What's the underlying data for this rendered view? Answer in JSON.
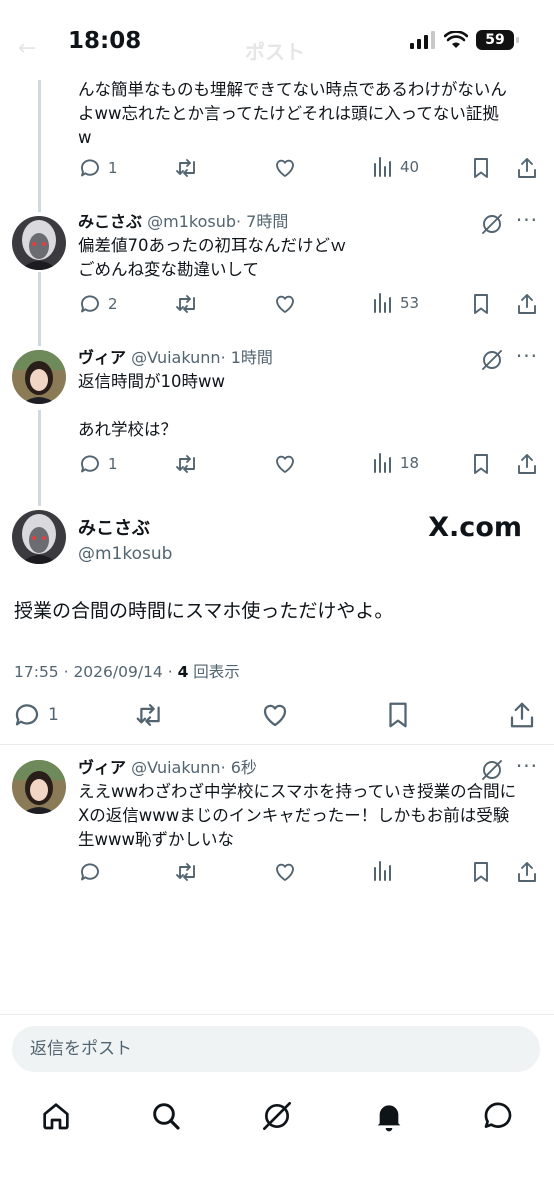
{
  "status_bar": {
    "time": "18:08",
    "battery": "59"
  },
  "header": {
    "title": "ポスト"
  },
  "tweets": [
    {
      "text": "んな簡単なものも埋解できてない時点であるわけがないん\nよww忘れたとか言ってたけどそれは頭に入ってない証拠\nw",
      "replies": "1",
      "views": "40"
    },
    {
      "name": "みこさぶ",
      "handle": "@m1kosub",
      "time": "· 7時間",
      "text": "偏差値70あったの初耳なんだけどｗ\nごめんね変な勘違いして",
      "replies": "2",
      "views": "53"
    },
    {
      "name": "ヴィア",
      "handle": "@Vuiakunn",
      "time": "· 1時間",
      "text": "返信時間が10時ww\n\nあれ学校は？",
      "replies": "1",
      "views": "18"
    }
  ],
  "main_tweet": {
    "name": "みこさぶ",
    "handle": "@m1kosub",
    "watermark": "X.com",
    "text": "授業の合間の時間にスマホ使っただけやよ。",
    "meta_date": "17:55 · 2026/09/14 · ",
    "views_count": "4",
    "views_label": " 回表示",
    "replies": "1"
  },
  "reply_tweet": {
    "name": "ヴィア",
    "handle": "@Vuiakunn",
    "time": "· 6秒",
    "text": "ええwwわざわざ中学校にスマホを持っていき授業の合間に\nXの返信wwwまじのインキャだったー！しかもお前は受験\n生www恥ずかしいな"
  },
  "composer": {
    "placeholder": "返信をポスト"
  },
  "bottom_nav": [
    "home-icon",
    "search-icon",
    "grok-icon",
    "notifications-icon",
    "messages-icon"
  ],
  "colors": {
    "text": "#0f1419",
    "secondary": "#536471",
    "thread": "#cfd9de",
    "composer_bg": "#eff3f4"
  }
}
